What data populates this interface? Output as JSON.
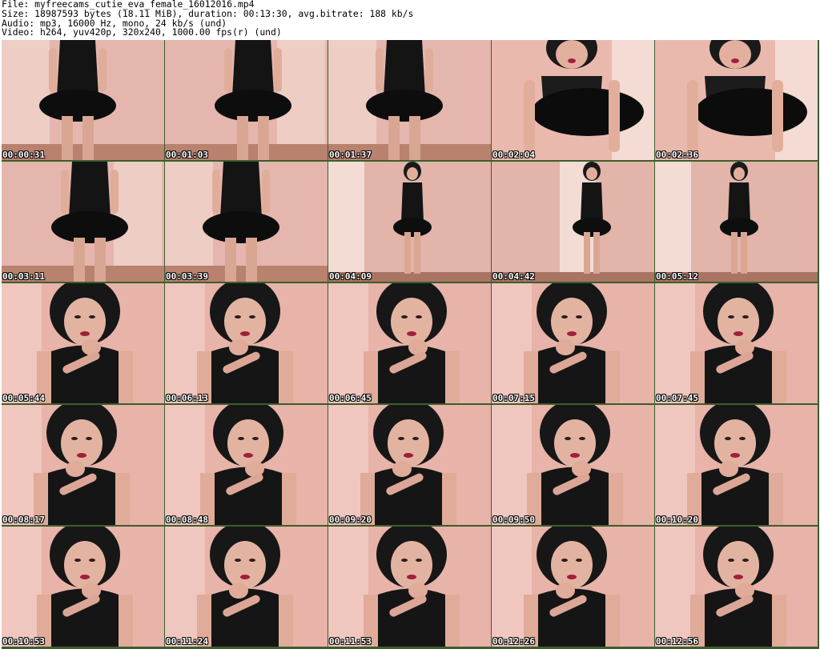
{
  "header": {
    "file": "File: myfreecams_cutie_eva_female_16012016.mp4",
    "size": "Size: 18987593 bytes (18.11 MiB), duration: 00:13:30, avg.bitrate: 188 kb/s",
    "audio": "Audio: mp3, 16000 Hz, mono, 24 kb/s (und)",
    "video": "Video: h264, yuv420p, 320x240, 1000.00 fps(r) (und)"
  },
  "thumbnails": [
    {
      "time": "00:00:31",
      "scene": "dancing-dress"
    },
    {
      "time": "00:01:03",
      "scene": "dancing-dress"
    },
    {
      "time": "00:01:37",
      "scene": "dancing-dress"
    },
    {
      "time": "00:02:04",
      "scene": "leaning-forward"
    },
    {
      "time": "00:02:36",
      "scene": "leaning-forward"
    },
    {
      "time": "00:03:11",
      "scene": "dancing-dress"
    },
    {
      "time": "00:03:39",
      "scene": "dancing-dress"
    },
    {
      "time": "00:04:09",
      "scene": "full-body-standing"
    },
    {
      "time": "00:04:42",
      "scene": "full-body-standing"
    },
    {
      "time": "00:05:12",
      "scene": "full-body-standing"
    },
    {
      "time": "00:05:44",
      "scene": "portrait"
    },
    {
      "time": "00:06:13",
      "scene": "portrait"
    },
    {
      "time": "00:06:45",
      "scene": "portrait"
    },
    {
      "time": "00:07:15",
      "scene": "portrait"
    },
    {
      "time": "00:07:45",
      "scene": "portrait"
    },
    {
      "time": "00:08:17",
      "scene": "portrait"
    },
    {
      "time": "00:08:48",
      "scene": "portrait"
    },
    {
      "time": "00:09:20",
      "scene": "portrait"
    },
    {
      "time": "00:09:50",
      "scene": "portrait"
    },
    {
      "time": "00:10:20",
      "scene": "portrait"
    },
    {
      "time": "00:10:53",
      "scene": "portrait"
    },
    {
      "time": "00:11:24",
      "scene": "portrait"
    },
    {
      "time": "00:11:53",
      "scene": "portrait"
    },
    {
      "time": "00:12:26",
      "scene": "portrait"
    },
    {
      "time": "00:12:56",
      "scene": "portrait"
    }
  ]
}
